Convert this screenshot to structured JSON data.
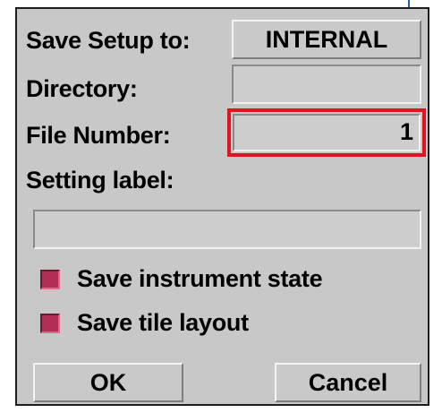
{
  "dialog": {
    "save_setup_label": "Save Setup to:",
    "save_setup_value": "INTERNAL",
    "directory_label": "Directory:",
    "directory_value": "",
    "file_number_label": "File Number:",
    "file_number_value": "1",
    "setting_label_label": "Setting label:",
    "setting_label_value": "",
    "save_instrument_state_label": "Save instrument state",
    "save_instrument_state_checked": true,
    "save_tile_layout_label": "Save tile layout",
    "save_tile_layout_checked": true,
    "ok_label": "OK",
    "cancel_label": "Cancel"
  },
  "colors": {
    "dialog_bg": "#c8c8c8",
    "checkbox_checked": "#b03055",
    "highlight_border": "#e0141e",
    "guide_line": "#2a56c8"
  }
}
